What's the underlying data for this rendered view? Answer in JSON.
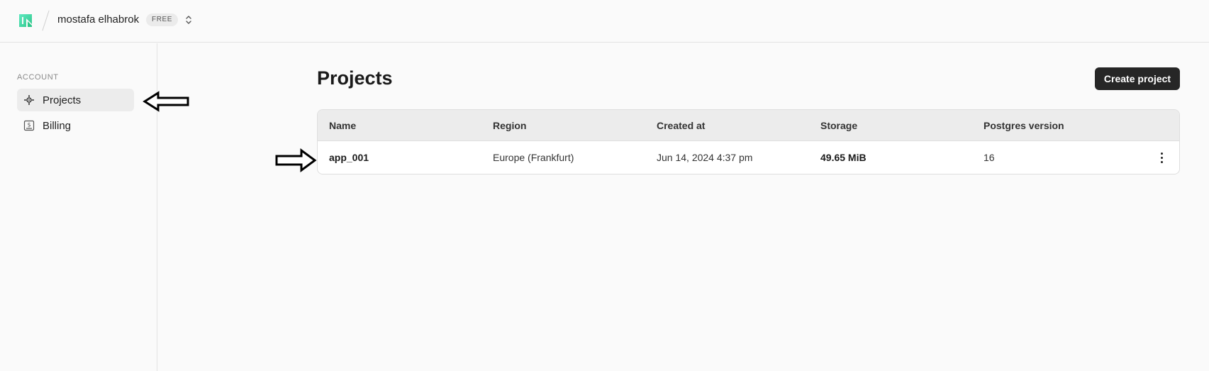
{
  "header": {
    "org_name": "mostafa elhabrok",
    "plan": "FREE",
    "brand_color": "#34d59a"
  },
  "sidebar": {
    "section_label": "ACCOUNT",
    "items": [
      {
        "label": "Projects",
        "icon": "projects-icon",
        "active": true
      },
      {
        "label": "Billing",
        "icon": "billing-icon",
        "active": false
      }
    ]
  },
  "main": {
    "title": "Projects",
    "create_button": "Create project",
    "table": {
      "columns": [
        "Name",
        "Region",
        "Created at",
        "Storage",
        "Postgres version"
      ],
      "rows": [
        {
          "name": "app_001",
          "region": "Europe (Frankfurt)",
          "created_at": "Jun 14, 2024 4:37 pm",
          "storage": "49.65 MiB",
          "postgres_version": "16"
        }
      ]
    }
  },
  "annotations": [
    {
      "icon": "left-arrow-icon",
      "points_to": "sidebar-item-projects"
    },
    {
      "icon": "right-arrow-icon",
      "points_to": "project-row-app_001"
    }
  ]
}
